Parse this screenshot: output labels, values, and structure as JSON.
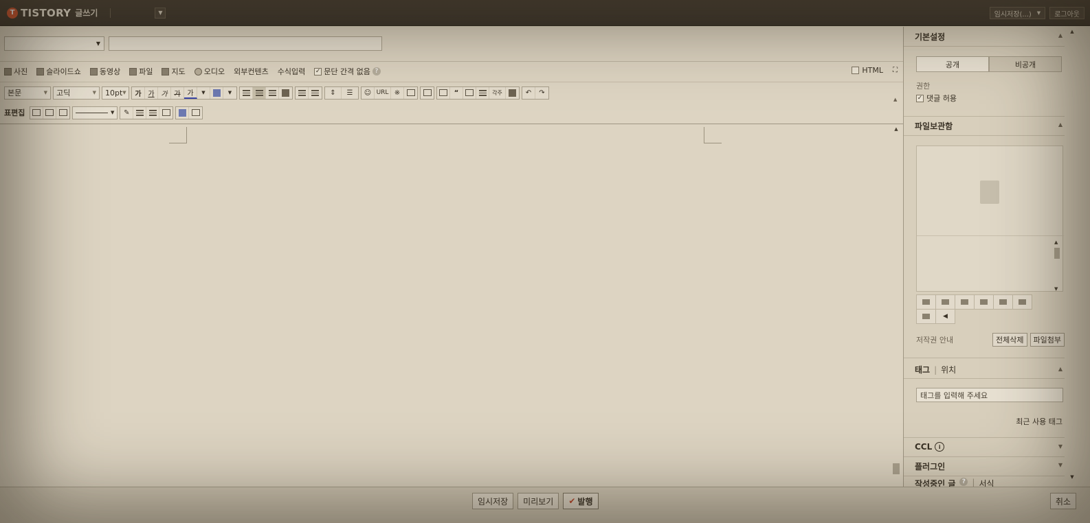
{
  "topbar": {
    "logo_mark": "T",
    "logo_text": "TISTORY",
    "logo_sub": "글쓰기",
    "autosave_label": "임시저장(...)",
    "logout_label": "로그아웃"
  },
  "editor": {
    "media_bar": {
      "photo": "사진",
      "slideshow": "슬라이드쇼",
      "video": "동영상",
      "file": "파일",
      "map": "지도",
      "audio": "오디오",
      "external": "외부컨텐츠",
      "formula": "수식입력",
      "no_paragraph_spacing": "문단 간격 없음",
      "html_toggle": "HTML"
    },
    "format_bar": {
      "style": "본문",
      "font": "고딕",
      "size": "10pt",
      "bold": "가",
      "italic": "가",
      "underline": "가",
      "strike": "가",
      "color": "가",
      "url": "URL",
      "special_char": "※",
      "quote": "“",
      "footnote": "각주",
      "undo": "↶",
      "redo": "↷",
      "table_edit_label": "표편집"
    }
  },
  "bottom": {
    "save_temp": "임시저장",
    "preview": "미리보기",
    "publish": "발행",
    "cancel": "취소"
  },
  "sidebar": {
    "basic_settings": "기본설정",
    "public": "공개",
    "private": "비공개",
    "permission_label": "권한",
    "allow_comments": "댓글 허용",
    "file_storage": "파일보관함",
    "copyright_guide": "저작권 안내",
    "delete_all": "전체삭제",
    "attach_file": "파일첨부",
    "tag_tab": "태그",
    "location_tab": "위치",
    "tag_placeholder": "태그를 입력해 주세요",
    "recent_tags": "최근 사용 태그",
    "ccl": "CCL",
    "plugin": "플러그인",
    "writing_note": "작성중인 글",
    "format": "서식"
  }
}
